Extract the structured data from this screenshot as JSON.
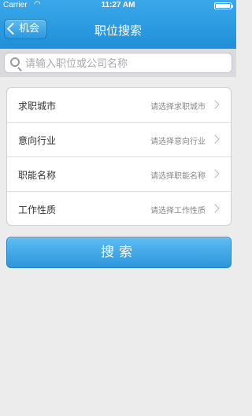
{
  "status_bar": {
    "carrier": "Carrier",
    "time": "11:27 AM",
    "wifi_icon": "wifi-icon",
    "battery_icon": "battery-icon"
  },
  "nav": {
    "back_label": "机会",
    "title": "职位搜索"
  },
  "search": {
    "placeholder": "请输入职位或公司名称",
    "value": ""
  },
  "form": {
    "rows": [
      {
        "label": "求职城市",
        "value": "请选择求职城市"
      },
      {
        "label": "意向行业",
        "value": "请选择意向行业"
      },
      {
        "label": "职能名称",
        "value": "请选择职能名称"
      },
      {
        "label": "工作性质",
        "value": "请选择工作性质"
      }
    ]
  },
  "actions": {
    "search_button": "搜索"
  },
  "colors": {
    "accent": "#2a96dd",
    "background": "#ececec"
  }
}
